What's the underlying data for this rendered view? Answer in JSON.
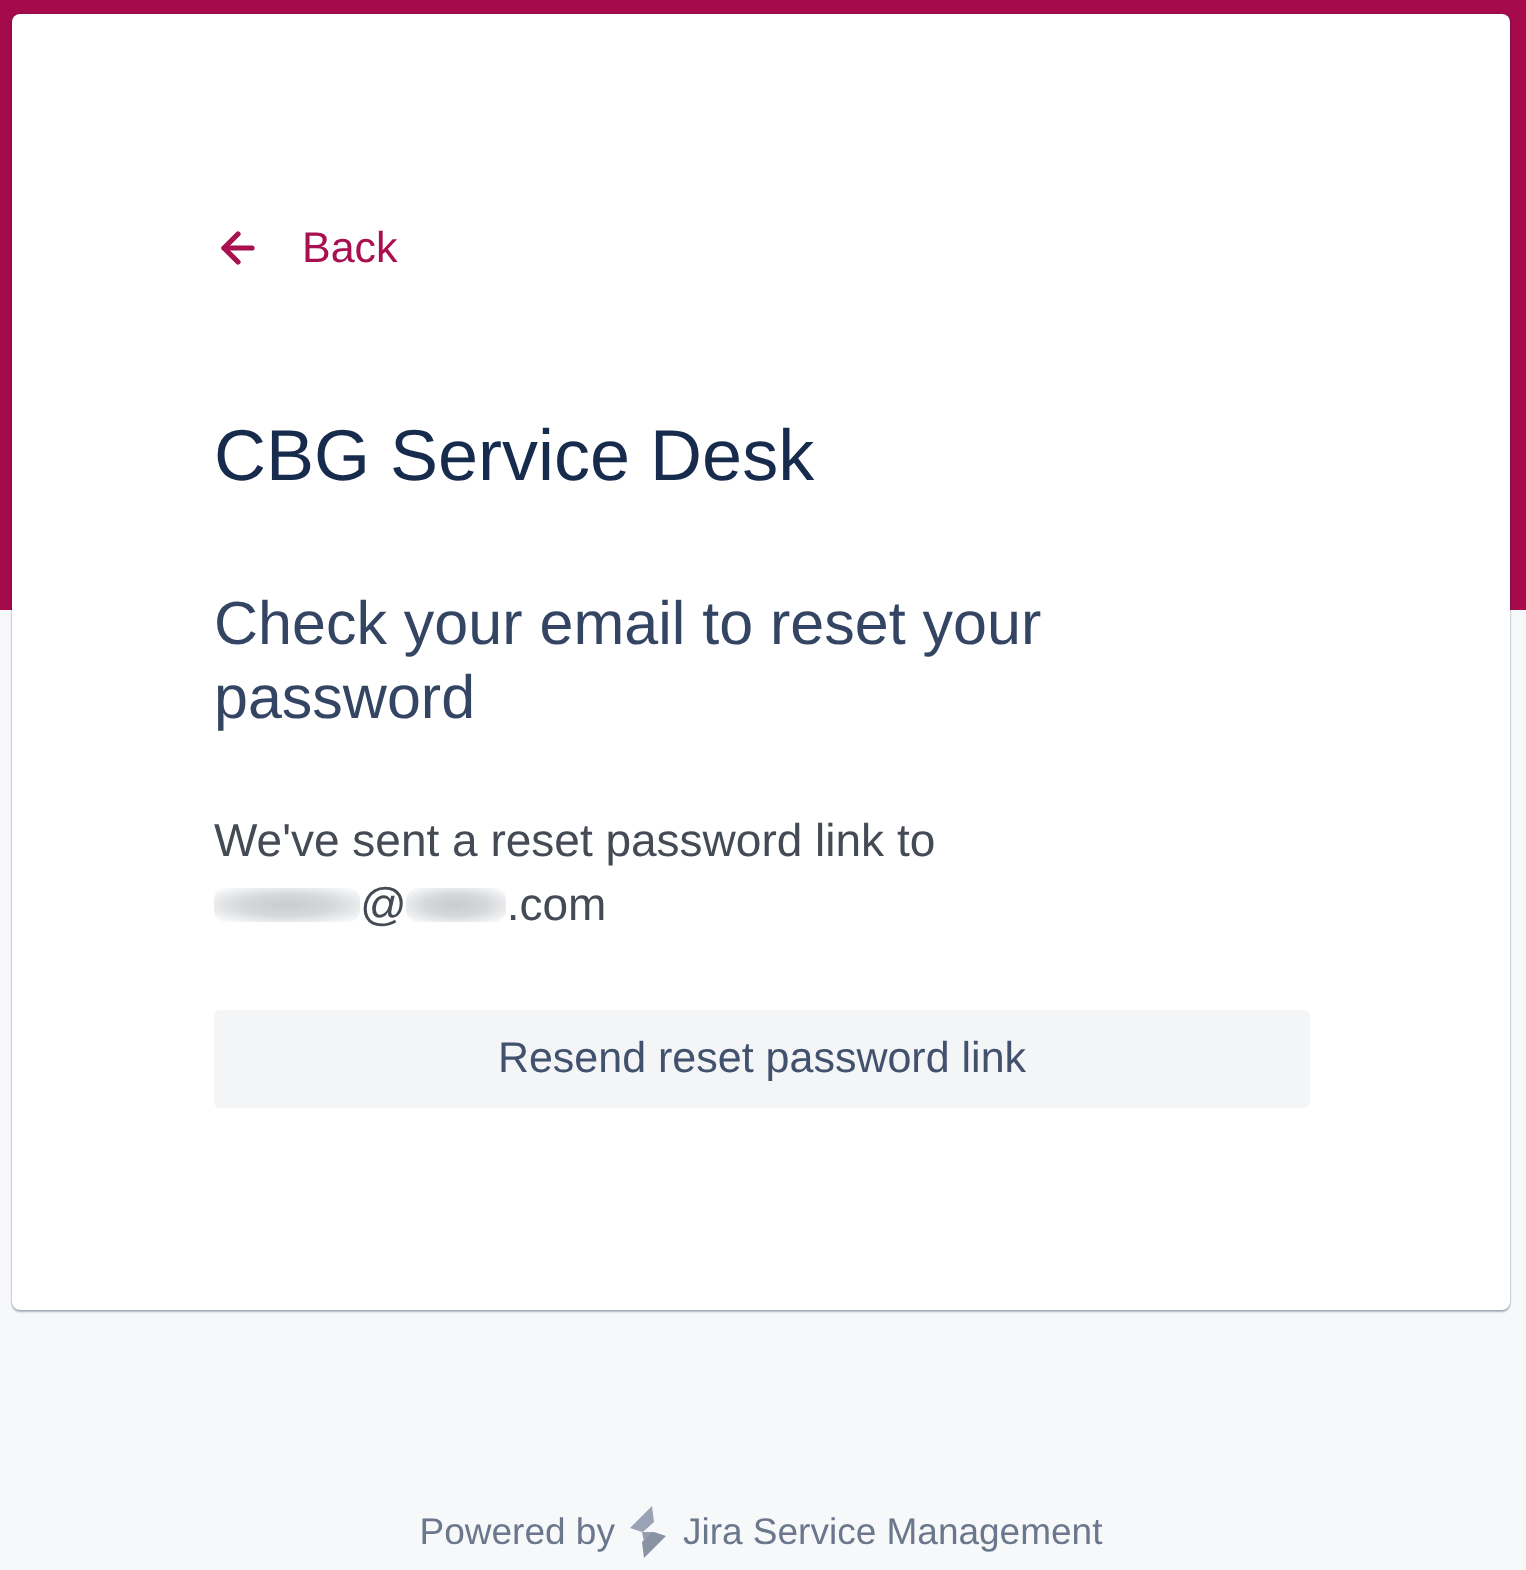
{
  "back_link": {
    "label": "Back"
  },
  "portal_title": "CBG Service Desk",
  "heading": "Check your email to reset your password",
  "message": {
    "text": "We've sent a reset password link to",
    "email": [
      {
        "kind": "redacted"
      },
      {
        "kind": "text",
        "text": "@"
      },
      {
        "kind": "redacted"
      },
      {
        "kind": "text",
        "text": ".com"
      }
    ]
  },
  "resend_button": {
    "label": "Resend reset password link"
  },
  "footer": {
    "prefix": "Powered by",
    "product": "Jira Service Management"
  }
}
